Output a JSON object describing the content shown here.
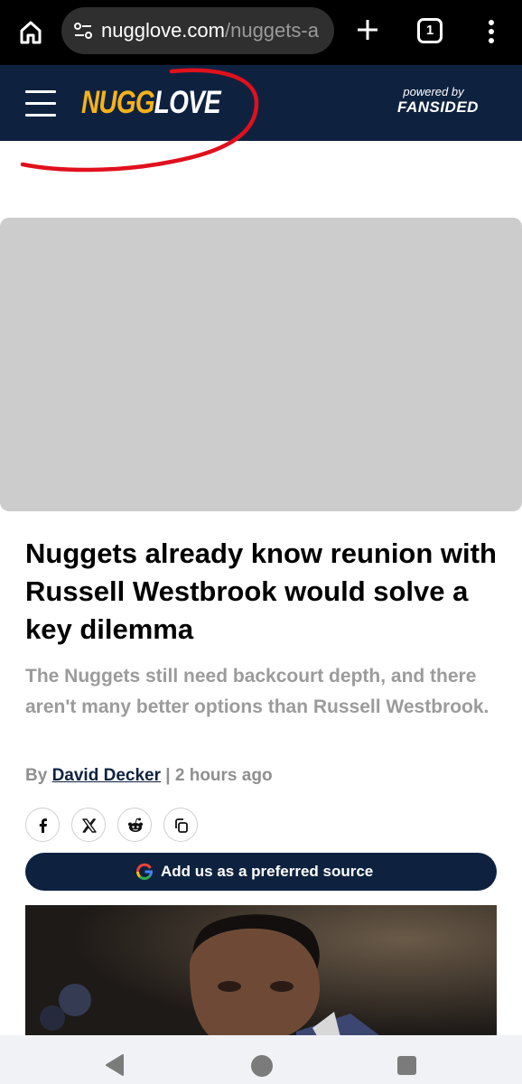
{
  "browser": {
    "url_domain": "nugglove.com",
    "url_path": "/nuggets-a",
    "tab_count": "1"
  },
  "header": {
    "logo_part1": "NUGG",
    "logo_part2": "LOVE",
    "powered_by": "powered by",
    "powered_brand": "FANSIDED"
  },
  "article": {
    "headline": "Nuggets already know reunion with Russell Westbrook would solve a key dilemma",
    "subheadline": "The Nuggets still need backcourt depth, and there aren't many better options than Russell Westbrook.",
    "byline_prefix": "By",
    "author": "David Decker",
    "separator": "|",
    "timestamp": "2 hours ago"
  },
  "share_icons": [
    "facebook-icon",
    "x-icon",
    "reddit-icon",
    "copy-link-icon"
  ],
  "preferred_source_label": "Add us as a preferred source",
  "colors": {
    "navy": "#0e2240",
    "gold": "#f5b31a",
    "annotation_red": "#e0101c",
    "placeholder_gray": "#cccccc"
  }
}
